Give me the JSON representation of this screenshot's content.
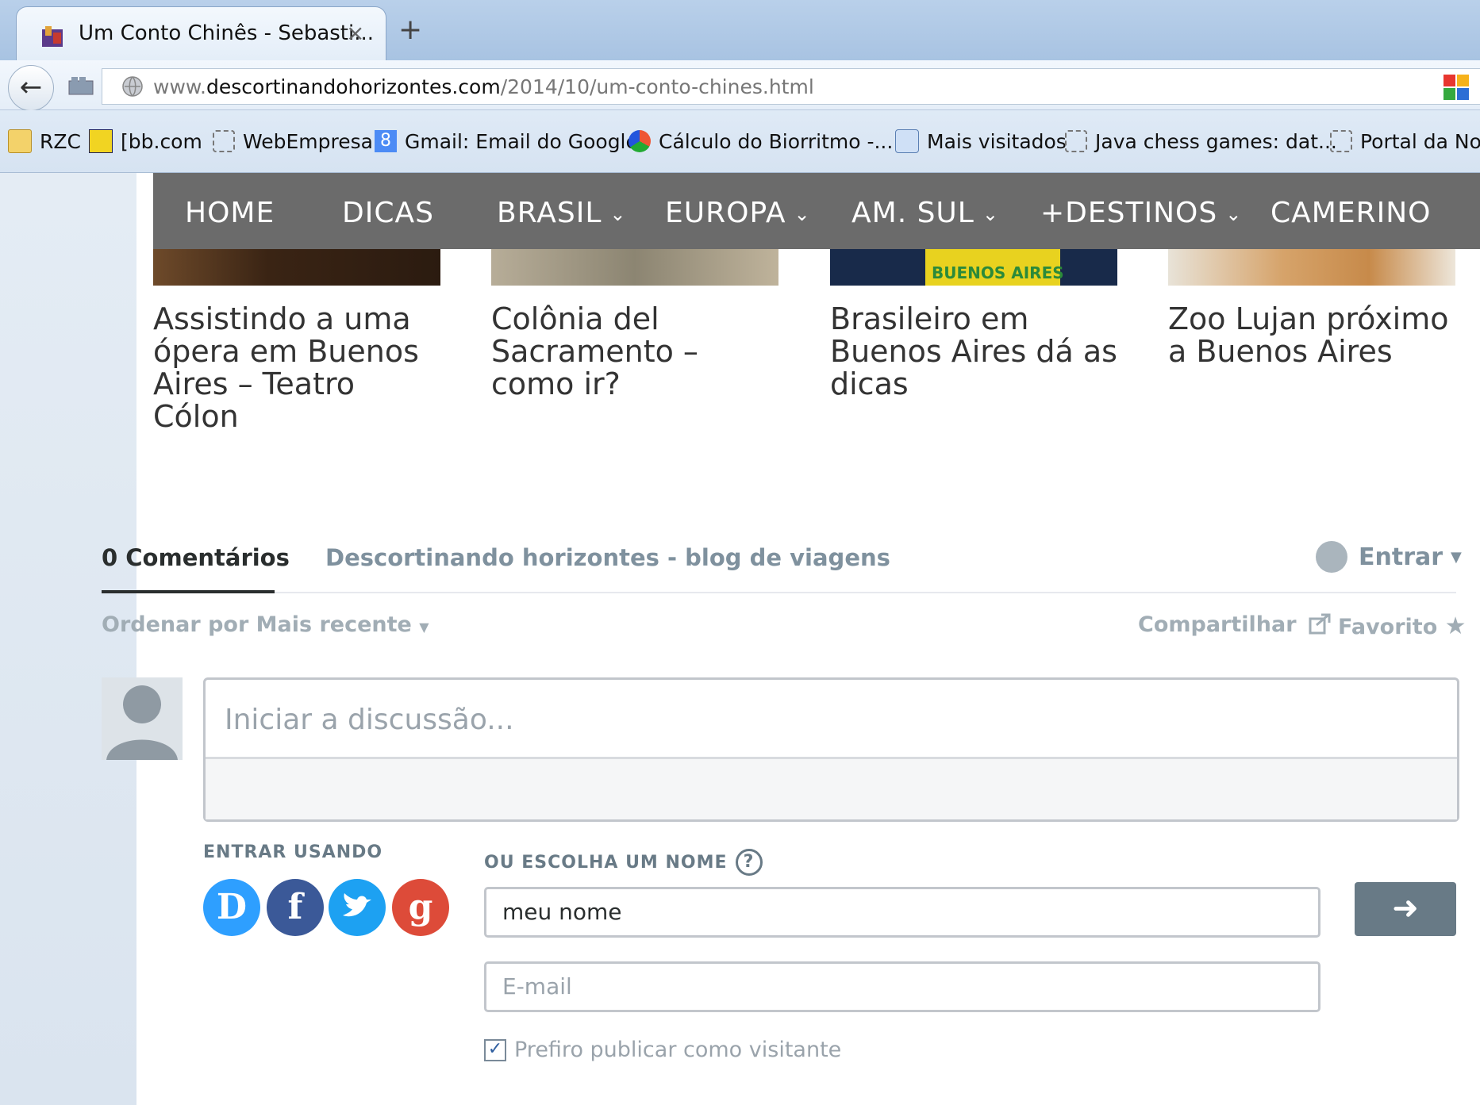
{
  "browser": {
    "tab_title": "Um Conto Chinês - Sebasti...",
    "tab_close": "×",
    "new_tab": "+",
    "back": "←",
    "url": {
      "prefix": "www.",
      "host": "descortinandohorizontes.com",
      "path": "/2014/10/um-conto-chines.html"
    },
    "bookmarks": [
      {
        "label": "RZC",
        "icon": "folder-icon"
      },
      {
        "label": "[bb.com",
        "icon": "bb-icon"
      },
      {
        "label": "WebEmpresa",
        "icon": "page-icon"
      },
      {
        "label": "Gmail: Email do Google",
        "icon": "google-icon"
      },
      {
        "label": "Cálculo do Biorritmo -...",
        "icon": "biorhythm-icon"
      },
      {
        "label": "Mais visitados",
        "icon": "most-visited-icon"
      },
      {
        "label": "Java chess games: dat...",
        "icon": "page-icon"
      },
      {
        "label": "Portal da Not",
        "icon": "page-icon"
      }
    ]
  },
  "site_nav": {
    "items": [
      "HOME",
      "DICAS",
      "BRASIL",
      "EUROPA",
      "AM. SUL",
      "+DESTINOS",
      "CAMERINO"
    ],
    "dropdown_chevron": "⌄"
  },
  "related_posts": [
    "Assistindo a uma ópera em Buenos Aires – Teatro Cólon",
    "Colônia del Sacramento – como ir?",
    "Brasileiro em Buenos Aires dá as dicas",
    "Zoo Lujan próximo a Buenos Aires"
  ],
  "related_thumb_text": "BUENOS AIRES",
  "comments": {
    "count_label": "0 Comentários",
    "site_label": "Descortinando horizontes - blog de viagens",
    "login_label": "Entrar",
    "sort_label": "Ordenar por Mais recente",
    "share_label": "Compartilhar",
    "favorite_label": "Favorito",
    "placeholder": "Iniciar a discussão...",
    "login_with_label": "ENTRAR USANDO",
    "or_choose_name_label": "OU ESCOLHA UM NOME",
    "help": "?",
    "name_value": "meu nome",
    "email_placeholder": "E-mail",
    "guest_label": "Prefiro publicar como visitante",
    "guest_checked": true,
    "social": [
      {
        "name": "disqus",
        "glyph": "D",
        "color": "#2e9fff"
      },
      {
        "name": "facebook",
        "glyph": "f",
        "color": "#3b5998"
      },
      {
        "name": "twitter",
        "glyph": "t",
        "color": "#1da1f2"
      },
      {
        "name": "google",
        "glyph": "g",
        "color": "#dd4b39"
      }
    ],
    "submit_arrow": "➜"
  }
}
